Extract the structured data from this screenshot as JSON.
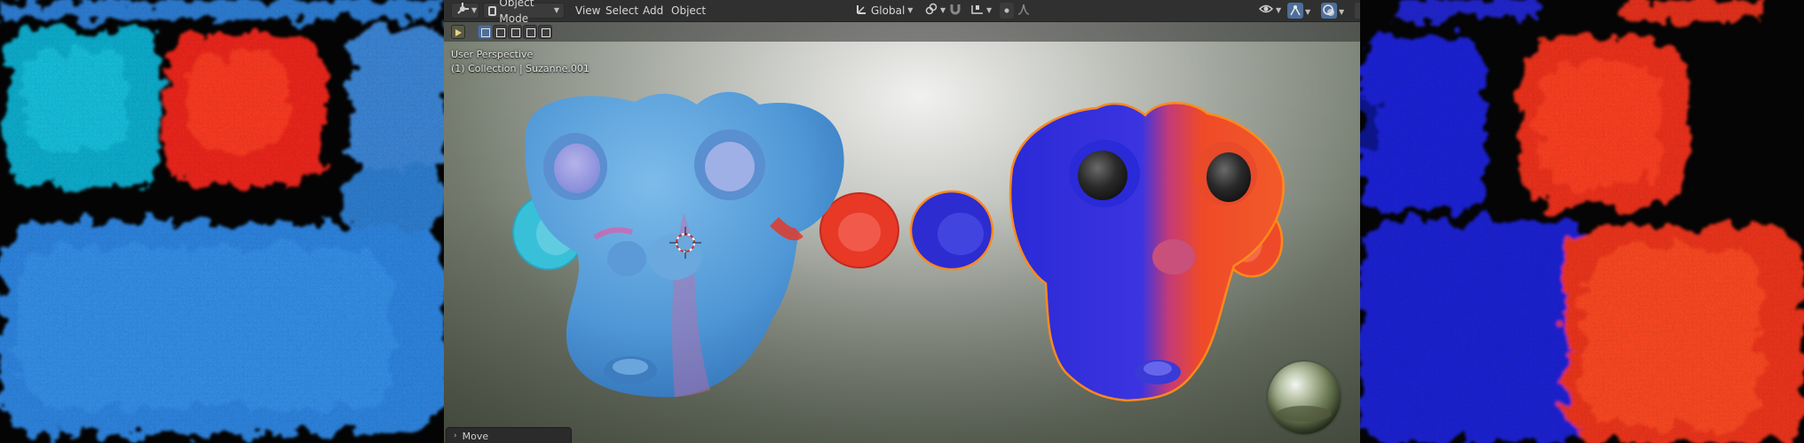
{
  "viewport": {
    "header": {
      "mode_label": "Object Mode",
      "menus": [
        "View",
        "Select",
        "Add",
        "Object"
      ],
      "transform_orientation": "Global"
    },
    "overlay": {
      "perspective": "User Perspective",
      "collection_info": "(1) Collection | Suzanne.001"
    },
    "last_operator": {
      "label": "Move"
    },
    "icons": {
      "editor_type": "viewport-editor-icon",
      "mode": "object-mode-icon",
      "orientation": "transform-orientation-icon",
      "pivot": "pivot-point-icon",
      "snap": "snap-magnet-icon",
      "proportional": "proportional-edit-icon",
      "visibility": "eye-visibility-icon",
      "gizmo": "gizmo-toggle-icon",
      "overlays": "overlays-toggle-icon",
      "environment": "hdri-preview-sphere"
    },
    "colors": {
      "header_bg": "#303030",
      "selection_outline": "#ff8a1c",
      "active_tool": "#4d6f9a"
    }
  }
}
